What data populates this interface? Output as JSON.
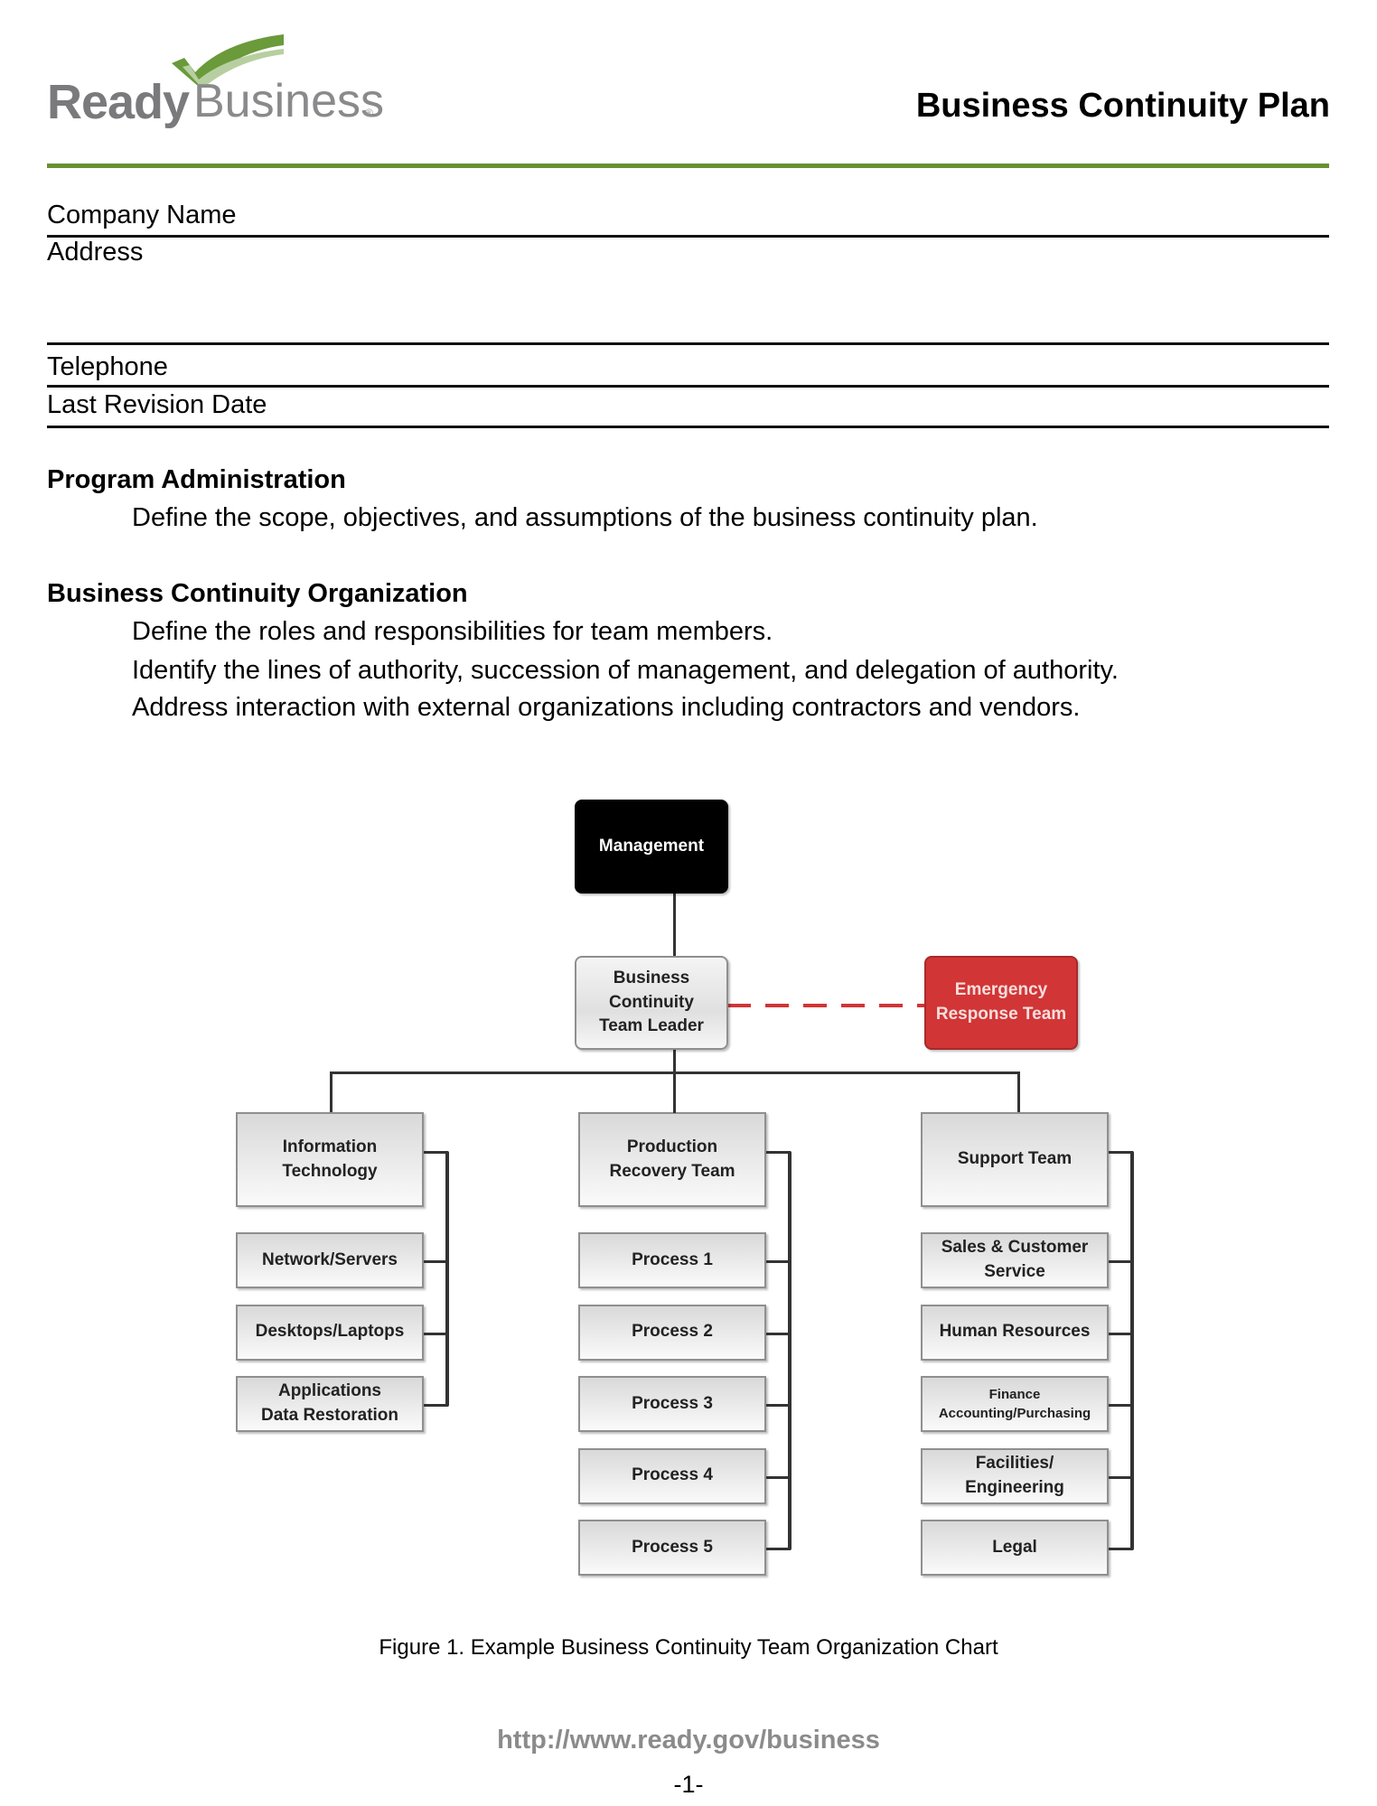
{
  "header": {
    "logo_word1": "Ready",
    "logo_word2": "Business",
    "logo_mark": "®",
    "title": "Business Continuity Plan",
    "accent_color": "#6a8f33"
  },
  "fields": [
    {
      "label": "Company Name",
      "value": ""
    },
    {
      "label": "Address",
      "value": ""
    },
    {
      "label": "Telephone",
      "value": ""
    },
    {
      "label": "Last Revision Date",
      "value": ""
    }
  ],
  "sections": [
    {
      "heading": "Program Administration",
      "lines": [
        "Define the scope, objectives, and assumptions of the business continuity plan."
      ]
    },
    {
      "heading": "Business Continuity Organization",
      "lines": [
        "Define the roles and responsibilities for team members.",
        "Identify the lines of authority, succession of management, and delegation of authority.",
        "Address interaction with external organizations including contractors and vendors."
      ]
    }
  ],
  "org_chart": {
    "top": "Management",
    "leader": "Business Continuity\nTeam Leader",
    "emergency": "Emergency\nResponse Team",
    "emergency_color": "#d23535",
    "columns": [
      {
        "head": "Information\nTechnology",
        "items": [
          "Network/Servers",
          "Desktops/Laptops",
          "Applications\nData Restoration"
        ]
      },
      {
        "head": "Production\nRecovery Team",
        "items": [
          "Process 1",
          "Process 2",
          "Process 3",
          "Process 4",
          "Process 5"
        ]
      },
      {
        "head": "Support Team",
        "items": [
          "Sales & Customer\nService",
          "Human Resources",
          "Finance\nAccounting/Purchasing",
          "Facilities/\nEngineering",
          "Legal"
        ]
      }
    ]
  },
  "caption": "Figure 1. Example Business Continuity Team Organization Chart",
  "footer": {
    "url": "http://www.ready.gov/business",
    "page": "-1-"
  }
}
